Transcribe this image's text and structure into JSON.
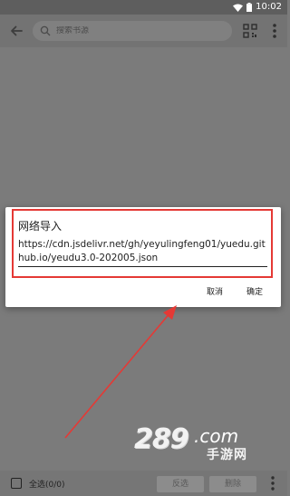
{
  "status_bar": {
    "time": "10:02"
  },
  "app_bar": {
    "search_placeholder": "搜索书源",
    "icons": [
      "back-arrow-icon",
      "search-icon",
      "qr-code-icon",
      "more-vert-icon"
    ]
  },
  "dialog": {
    "title": "网络导入",
    "url": "https://cdn.jsdelivr.net/gh/yeyulingfeng01/yuedu.github.io/yeudu3.0-202005.json",
    "cancel_label": "取消",
    "confirm_label": "确定",
    "highlight_color": "#e53935"
  },
  "bottom_bar": {
    "select_all_label": "全选(0/0)",
    "invert_label": "反选",
    "delete_label": "删除"
  },
  "watermark": {
    "brand_number": "289",
    "brand_suffix": ".com",
    "brand_cn": "手游网"
  },
  "colors": {
    "overlay": "#7b7b7b",
    "arrow": "#e53935"
  }
}
